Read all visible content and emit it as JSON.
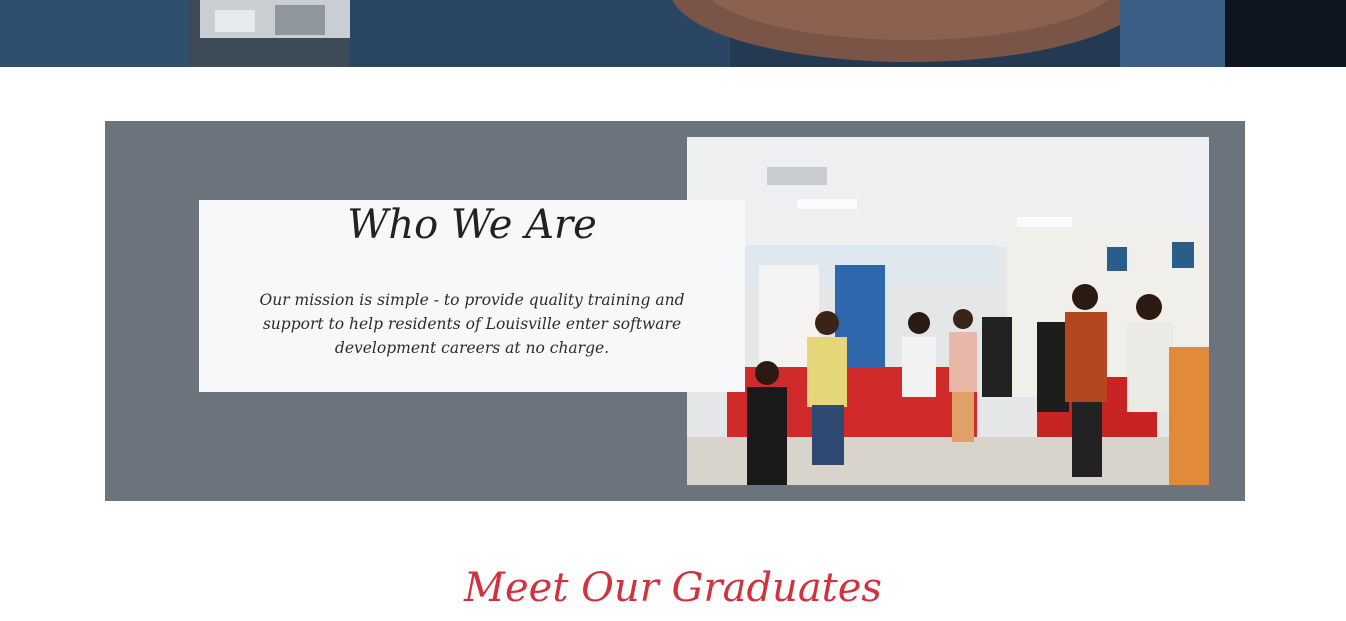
{
  "about": {
    "title": "Who We Are",
    "text": "Our mission is simple - to provide quality training and support to help residents of Louisville enter software development careers at no charge."
  },
  "graduates": {
    "heading": "Meet Our Graduates"
  },
  "colors": {
    "band": "#6b737c",
    "card": "#f7f8f9",
    "accent": "#d2323f"
  }
}
